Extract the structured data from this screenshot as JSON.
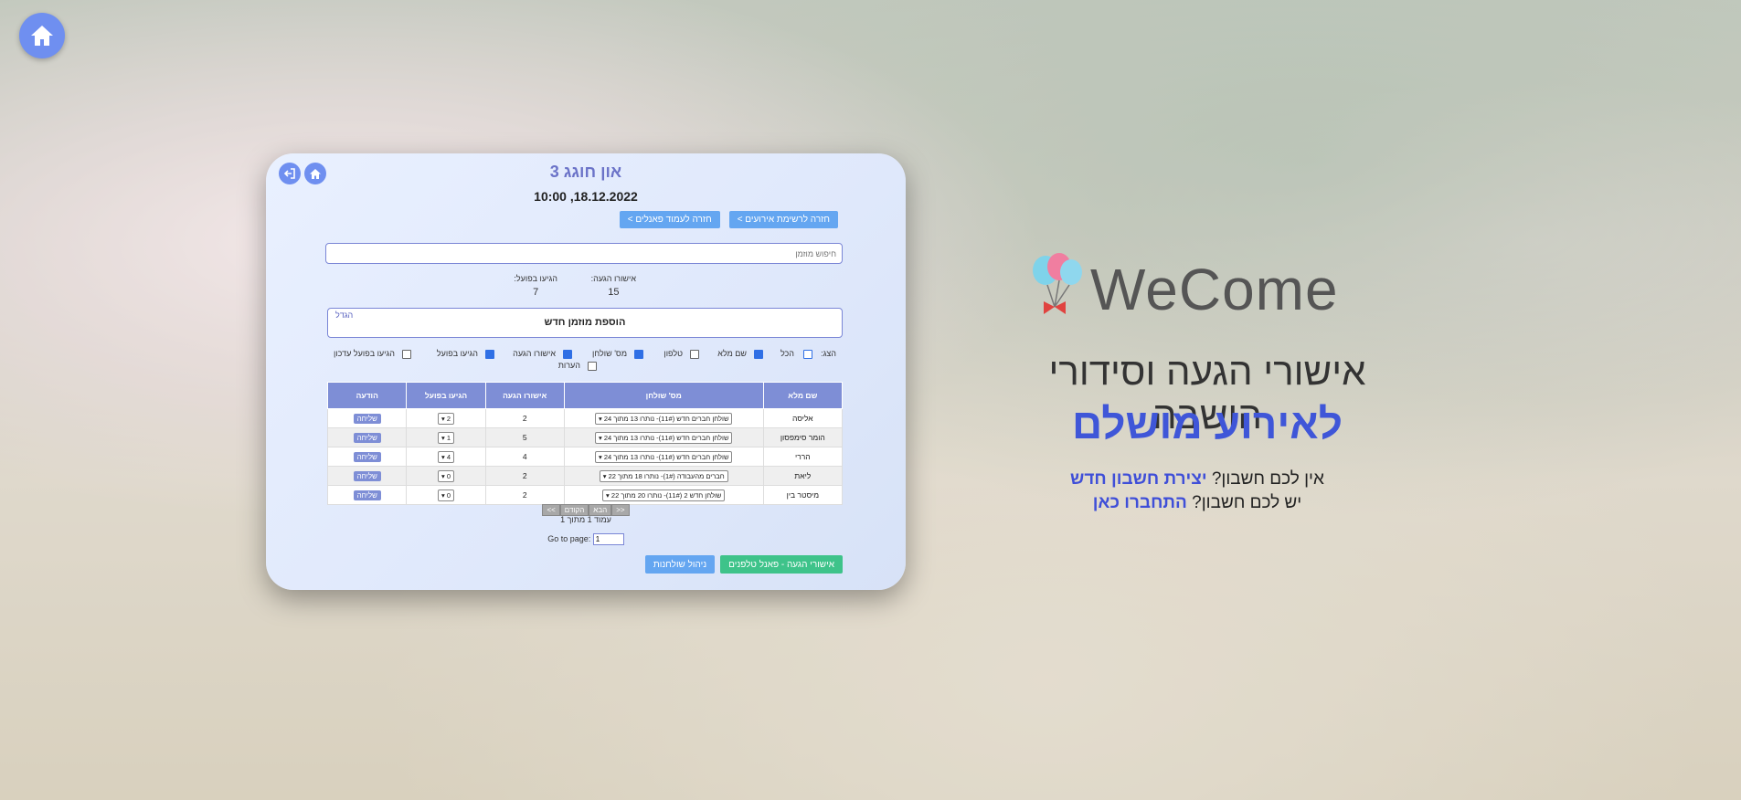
{
  "event": {
    "title": "און חוגג 3",
    "date": "18.12.2022, 10:00",
    "back_events": "חזרה לרשימת אירועים >",
    "back_panels": "חזרה לעמוד פאנלים >"
  },
  "search": {
    "placeholder": "חיפוש מוזמן"
  },
  "stats": {
    "confirmed_label": "אישורו הגעה:",
    "confirmed_value": "15",
    "arrived_label": "הגיעו בפועל:",
    "arrived_value": "7"
  },
  "add_guest": {
    "expand_label": "הגדל",
    "label": "הוספת מוזמן חדש"
  },
  "filters": {
    "show_label": "הצג:",
    "items": [
      "הכל",
      "שם מלא",
      "טלפון",
      "מס' שולחן",
      "אישורו הגעה",
      "הגיעו בפועל",
      "הגיעו בפועל עדכון",
      "הערות"
    ]
  },
  "table": {
    "headers": [
      "שם מלא",
      "מס' שולחן",
      "אישורו הגעה",
      "הגיעו בפועל",
      "הודעה"
    ],
    "rows": [
      {
        "name": "אליסה",
        "table": "שולחן חברים חדש (11#)- נותרו 13 מתוך 24",
        "confirmed": "2",
        "arrived": "2",
        "send": "שליחה"
      },
      {
        "name": "הומר סימפסון",
        "table": "שולחן חברים חדש (11#)- נותרו 13 מתוך 24",
        "confirmed": "5",
        "arrived": "1",
        "send": "שליחה"
      },
      {
        "name": "הררי",
        "table": "שולחן חברים חדש (11#)- נותרו 13 מתוך 24",
        "confirmed": "4",
        "arrived": "4",
        "send": "שליחה"
      },
      {
        "name": "ליאת",
        "table": "חברים מהעבודה (1#)- נותרו 18 מתוך 22",
        "confirmed": "2",
        "arrived": "0",
        "send": "שליחה"
      },
      {
        "name": "מיסטר בין",
        "table": "שולחן חדש 2 (11#)- נותרו 20 מתוך 22",
        "confirmed": "2",
        "arrived": "0",
        "send": "שליחה"
      }
    ]
  },
  "pager": {
    "first": "<<",
    "prev": "הקודם",
    "next": "הבא",
    "last": ">>",
    "info": "עמוד 1 מתוך 1",
    "goto_label": "Go to page:",
    "goto_value": "1"
  },
  "actions": {
    "phone_panel": "אישורי הגעה - פאנל טלפנים",
    "tables": "ניהול שולחנות"
  },
  "landing": {
    "logo_text": "WeCome",
    "headline1": "אישורי הגעה וסידורי הושבה",
    "headline2": "לאירוע מושלם",
    "no_account": "אין לכם חשבון?",
    "create_account": "יצירת חשבון חדש",
    "have_account": "יש לכם חשבון?",
    "login": "התחברו כאן"
  },
  "colors": {
    "accent": "#6f8ff0",
    "brand": "#3f56d8",
    "header": "#7e8ed6",
    "green": "#3ec38a"
  }
}
